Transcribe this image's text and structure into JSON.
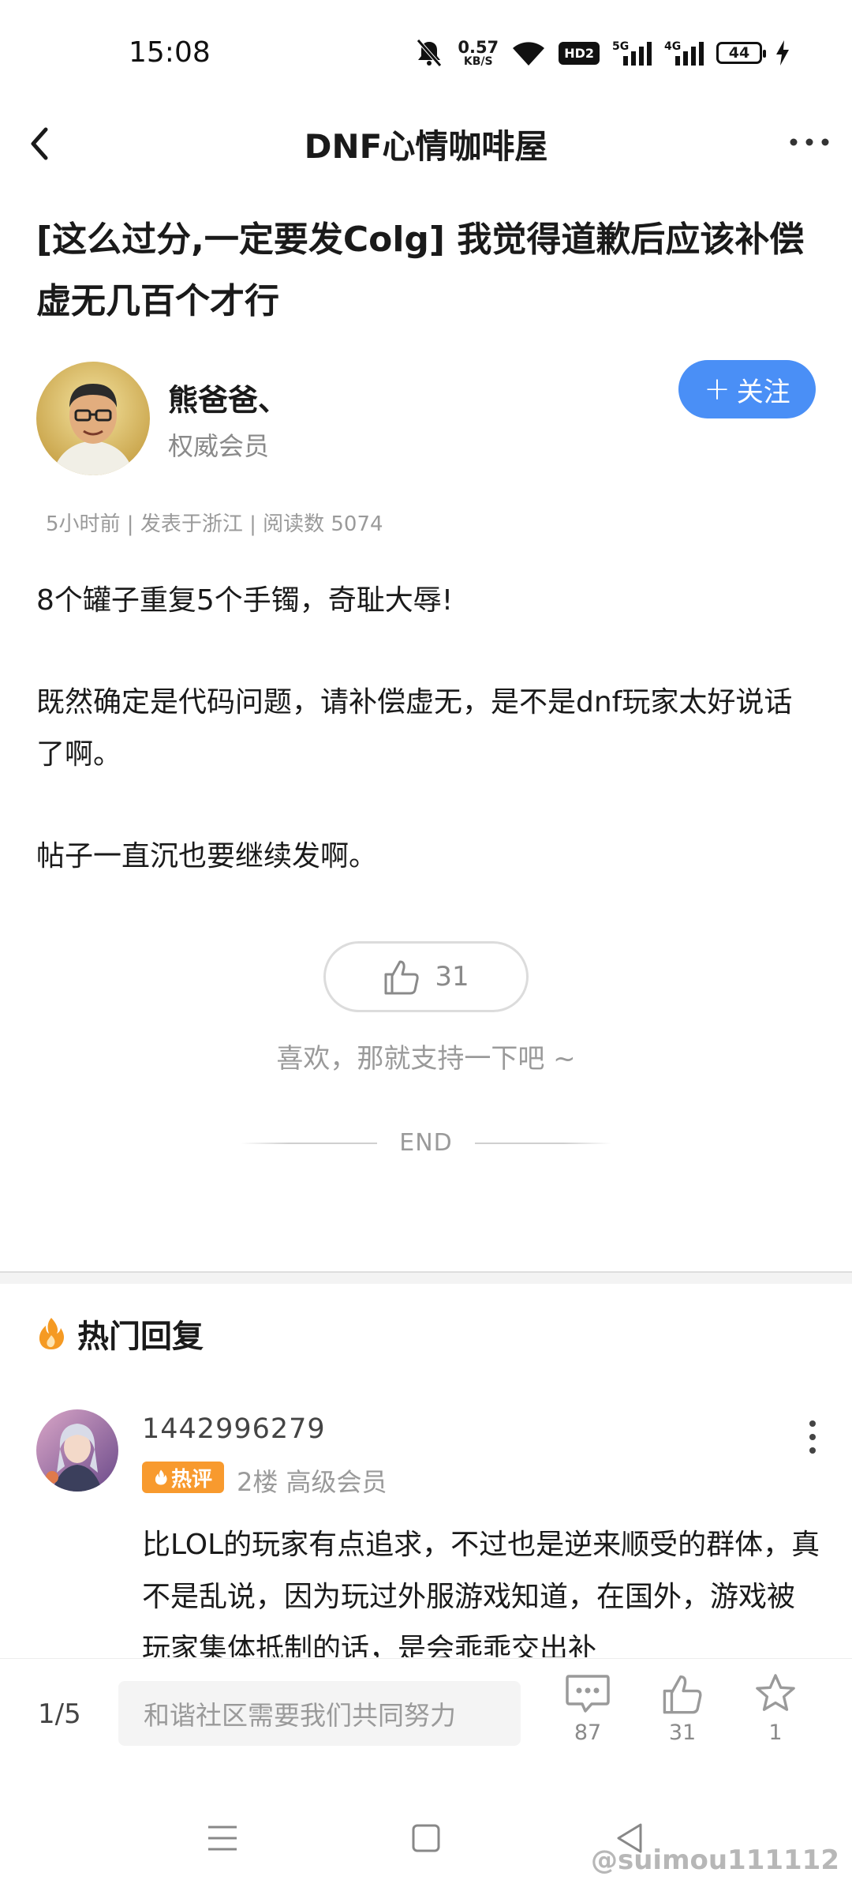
{
  "status_bar": {
    "time": "15:08",
    "net_speed_value": "0.57",
    "net_speed_unit": "KB/S",
    "hd": "HD2",
    "signal_1": "5G",
    "signal_2": "4G",
    "battery": "44"
  },
  "nav": {
    "title": "DNF心情咖啡屋"
  },
  "post": {
    "title": "[这么过分,一定要发Colg] 我觉得道歉后应该补偿虚无几百个才行",
    "author_name": "熊爸爸、",
    "author_rank": "权威会员",
    "follow_label": "关注",
    "meta": "5小时前 | 发表于浙江 | 阅读数 5074",
    "paragraphs": [
      "8个罐子重复5个手镯，奇耻大辱!",
      "既然确定是代码问题，请补偿虚无，是不是dnf玩家太好说话了啊。",
      "帖子一直沉也要继续发啊。"
    ],
    "like_count": "31",
    "like_hint": "喜欢，那就支持一下吧 ~",
    "end_label": "END"
  },
  "hot_replies": {
    "header": "热门回复",
    "items": [
      {
        "user": "1442996279",
        "badge": "热评",
        "floor_rank": "2楼 高级会员",
        "text": "比LOL的玩家有点追求，不过也是逆来顺受的群体，真不是乱说，因为玩过外服游戏知道，在国外，游戏被玩家集体抵制的话，是会乖乖交出补"
      }
    ]
  },
  "toolbar": {
    "page": "1/5",
    "input_placeholder": "和谐社区需要我们共同努力",
    "comment_count": "87",
    "like_count": "31",
    "favorite_count": "1"
  },
  "watermark": "@suimou111112",
  "colors": {
    "accent": "#4a8ff6",
    "hot_badge": "#f89a2e",
    "fire": "#f59a23"
  }
}
